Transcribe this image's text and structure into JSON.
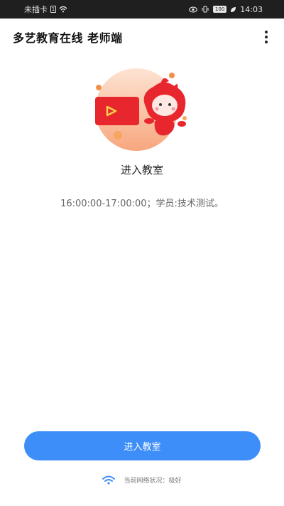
{
  "status_bar": {
    "carrier": "未插卡",
    "battery": "100",
    "time": "14:03"
  },
  "app_bar": {
    "title": "多艺教育在线 老师端",
    "menu_icon": "more-vert-icon"
  },
  "main": {
    "room_title": "进入教室",
    "schedule": "16:00:00-17:00:00；学员:技术测试。"
  },
  "footer": {
    "enter_button_label": "进入教室",
    "network_icon": "wifi-icon",
    "network_status": "当前网络状况：极好"
  },
  "colors": {
    "accent": "#3d8ef8",
    "mascot": "#e8262d",
    "status_bar_bg": "#1f1f1f"
  }
}
